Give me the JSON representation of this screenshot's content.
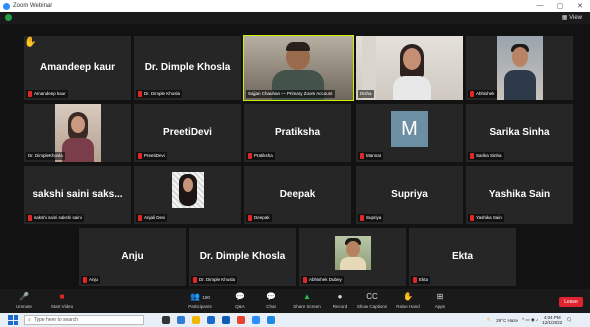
{
  "window": {
    "title": "Zoom Webinar",
    "controls": [
      "—",
      "▢",
      "✕"
    ]
  },
  "top": {
    "view_label": "View"
  },
  "tiles": [
    {
      "name": "Amandeep kaur",
      "caption": "Amandeep kaur"
    },
    {
      "name": "Dr. Dimple Khosla",
      "caption": "Dr. Dimple Khosla"
    },
    {
      "name": "",
      "caption": "Sajjan Chauhan — Primary Zoom Account"
    },
    {
      "name": "",
      "caption": "Disha"
    },
    {
      "name": "",
      "caption": "Abhishek"
    },
    {
      "name": "",
      "caption": "Dr. DimpleKhosla"
    },
    {
      "name": "PreetiDevi",
      "caption": "PreetiDevi"
    },
    {
      "name": "Pratiksha",
      "caption": "Pratiksha"
    },
    {
      "name": "",
      "caption": "Mannat",
      "avatar": "M"
    },
    {
      "name": "Sarika Sinha",
      "caption": "Sarika Sinha"
    },
    {
      "name": "sakshi saini saks...",
      "caption": "sakshi saini sakshi saini"
    },
    {
      "name": "",
      "caption": "Anjali Devi"
    },
    {
      "name": "Deepak",
      "caption": "Deepak"
    },
    {
      "name": "Supriya",
      "caption": "Supriya"
    },
    {
      "name": "Yashika Sain",
      "caption": "Yashika Sain"
    },
    {
      "name": "Anju",
      "caption": "Anju"
    },
    {
      "name": "Dr. Dimple Khosla",
      "caption": "Dr. Dimple Khosla"
    },
    {
      "name": "",
      "caption": "Abhishek Dubey"
    },
    {
      "name": "Ekta",
      "caption": "Ekta"
    }
  ],
  "toolbar": {
    "unmute": "Unmute",
    "start_video": "Start Video",
    "participants": "Participants",
    "participants_count": "100",
    "qa": "Q&A",
    "chat": "Chat",
    "share_screen": "Share Screen",
    "record": "Record",
    "captions": "Show Captions",
    "raise_hand": "Raise Hand",
    "apps": "Apps",
    "leave": "Leave"
  },
  "taskbar": {
    "search_placeholder": "Type here to search",
    "weather": "29°C Haze",
    "time": "4:04 PM",
    "date": "12/1/2022"
  },
  "colors": {
    "active_speaker": "#c8f200",
    "leave": "#e0242f",
    "mic_muted": "#e02828"
  }
}
